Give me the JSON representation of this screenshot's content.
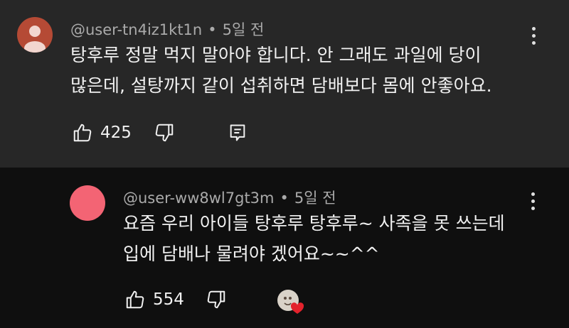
{
  "comments": [
    {
      "author": "@user-tn4iz1kt1n",
      "separator": "•",
      "time": "5일 전",
      "avatar_color": "#b54a35",
      "lines": [
        "탕후루 정말 먹지 말아야 합니다. 안 그래도 과일에 당이",
        "많은데, 설탕까지 같이 섭취하면 담배보다 몸에 안좋아요."
      ],
      "likes": "425",
      "icons": [
        "thumbs-up-icon",
        "thumbs-down-icon",
        "reply-icon",
        "more-vert-icon"
      ]
    },
    {
      "author": "@user-ww8wl7gt3m",
      "separator": "•",
      "time": "5일 전",
      "avatar_color": "#f36474",
      "lines": [
        "요즘 우리 아이들 탕후루 탕후루~ 사족을 못 쓰는데",
        "입에 담배나 물려야 겠어요~~^^"
      ],
      "likes": "554",
      "icons": [
        "thumbs-up-icon",
        "thumbs-down-icon",
        "creator-heart-icon",
        "more-vert-icon"
      ]
    }
  ]
}
